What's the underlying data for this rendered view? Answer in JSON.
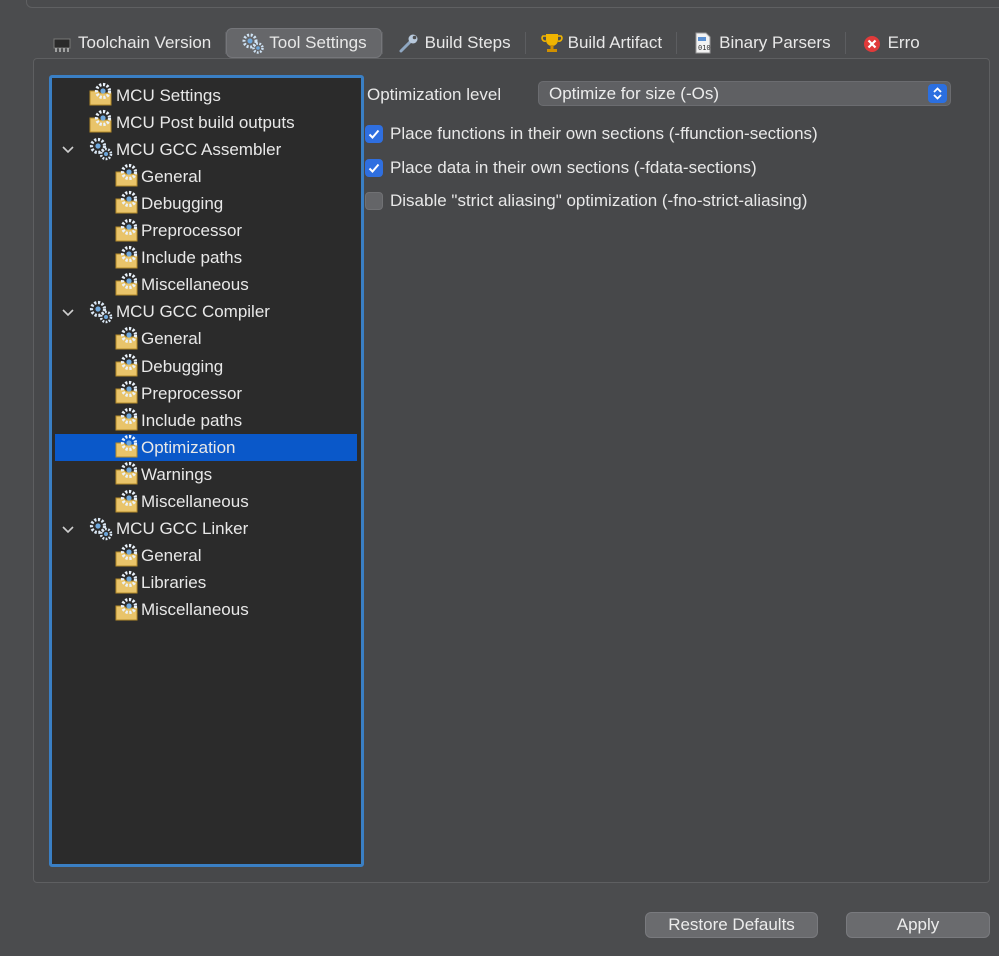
{
  "tabs": [
    {
      "label": "Toolchain Version",
      "icon": "chip-icon"
    },
    {
      "label": "Tool Settings",
      "icon": "gear-cluster-icon",
      "selected": true
    },
    {
      "label": "Build Steps",
      "icon": "wrench-icon"
    },
    {
      "label": "Build Artifact",
      "icon": "trophy-icon"
    },
    {
      "label": "Binary Parsers",
      "icon": "binary-file-icon"
    },
    {
      "label": "Erro",
      "icon": "error-icon"
    }
  ],
  "tree": [
    {
      "label": "MCU Settings",
      "level": 0,
      "expandable": false
    },
    {
      "label": "MCU Post build outputs",
      "level": 0,
      "expandable": false
    },
    {
      "label": "MCU GCC Assembler",
      "level": 0,
      "expandable": true
    },
    {
      "label": "General",
      "level": 1
    },
    {
      "label": "Debugging",
      "level": 1
    },
    {
      "label": "Preprocessor",
      "level": 1
    },
    {
      "label": "Include paths",
      "level": 1
    },
    {
      "label": "Miscellaneous",
      "level": 1
    },
    {
      "label": "MCU GCC Compiler",
      "level": 0,
      "expandable": true
    },
    {
      "label": "General",
      "level": 1
    },
    {
      "label": "Debugging",
      "level": 1
    },
    {
      "label": "Preprocessor",
      "level": 1
    },
    {
      "label": "Include paths",
      "level": 1
    },
    {
      "label": "Optimization",
      "level": 1,
      "selected": true
    },
    {
      "label": "Warnings",
      "level": 1
    },
    {
      "label": "Miscellaneous",
      "level": 1
    },
    {
      "label": "MCU GCC Linker",
      "level": 0,
      "expandable": true
    },
    {
      "label": "General",
      "level": 1
    },
    {
      "label": "Libraries",
      "level": 1
    },
    {
      "label": "Miscellaneous",
      "level": 1
    }
  ],
  "settings": {
    "optimization_label": "Optimization level",
    "optimization_value": "Optimize for size (-Os)",
    "checkboxes": [
      {
        "label": "Place functions in their own sections (-ffunction-sections)",
        "checked": true
      },
      {
        "label": "Place data in their own sections (-fdata-sections)",
        "checked": true
      },
      {
        "label": "Disable \"strict aliasing\" optimization (-fno-strict-aliasing)",
        "checked": false
      }
    ]
  },
  "buttons": {
    "restore_defaults": "Restore Defaults",
    "apply": "Apply"
  },
  "colors": {
    "selection": "#0a58c9",
    "accent": "#2f6fe0",
    "tree_border": "#3a7fc4"
  }
}
